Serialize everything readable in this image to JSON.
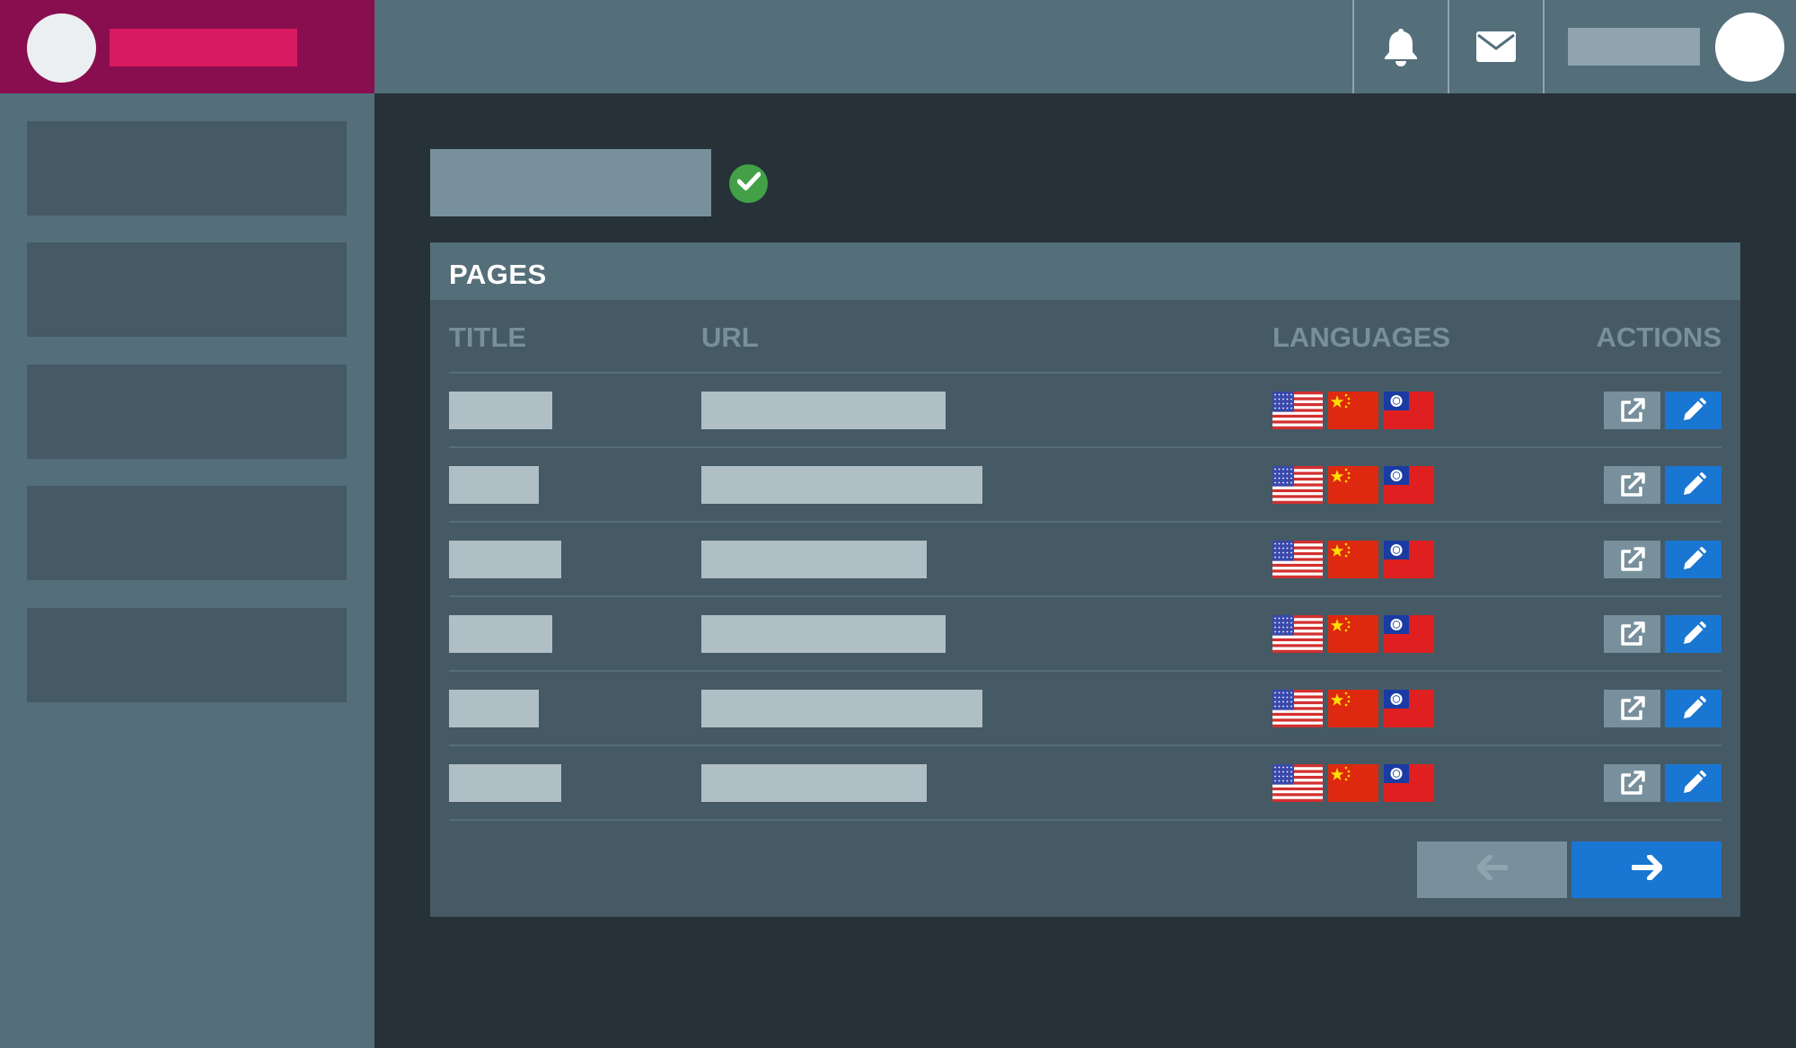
{
  "brand": {
    "logo_icon": "avatar-circle",
    "name_placeholder": ""
  },
  "topbar": {
    "notifications_icon": "bell-icon",
    "messages_icon": "envelope-icon",
    "user_name_placeholder": "",
    "user_avatar": "avatar-circle"
  },
  "sidebar": {
    "items": [
      "",
      "",
      "",
      "",
      ""
    ]
  },
  "page": {
    "title_placeholder": "",
    "status_icon": "check-circle-icon",
    "status_color": "#43a047"
  },
  "panel": {
    "title": "PAGES",
    "columns": {
      "title": "TITLE",
      "url": "URL",
      "languages": "LANGUAGES",
      "actions": "ACTIONS"
    },
    "rows": [
      {
        "title": "",
        "url": "",
        "languages": [
          "en-US",
          "zh-CN",
          "zh-TW"
        ]
      },
      {
        "title": "",
        "url": "",
        "languages": [
          "en-US",
          "zh-CN",
          "zh-TW"
        ]
      },
      {
        "title": "",
        "url": "",
        "languages": [
          "en-US",
          "zh-CN",
          "zh-TW"
        ]
      },
      {
        "title": "",
        "url": "",
        "languages": [
          "en-US",
          "zh-CN",
          "zh-TW"
        ]
      },
      {
        "title": "",
        "url": "",
        "languages": [
          "en-US",
          "zh-CN",
          "zh-TW"
        ]
      },
      {
        "title": "",
        "url": "",
        "languages": [
          "en-US",
          "zh-CN",
          "zh-TW"
        ]
      }
    ],
    "actions": {
      "open_icon": "external-link-icon",
      "edit_icon": "pencil-icon"
    },
    "pagination": {
      "prev_icon": "arrow-left-icon",
      "next_icon": "arrow-right-icon"
    }
  },
  "colors": {
    "brand_bg": "#880e4f",
    "brand_accent": "#d81b60",
    "topbar_bg": "#546e7a",
    "content_bg": "#263238",
    "panel_bg": "#455a64",
    "primary": "#1976d2",
    "success": "#43a047"
  }
}
